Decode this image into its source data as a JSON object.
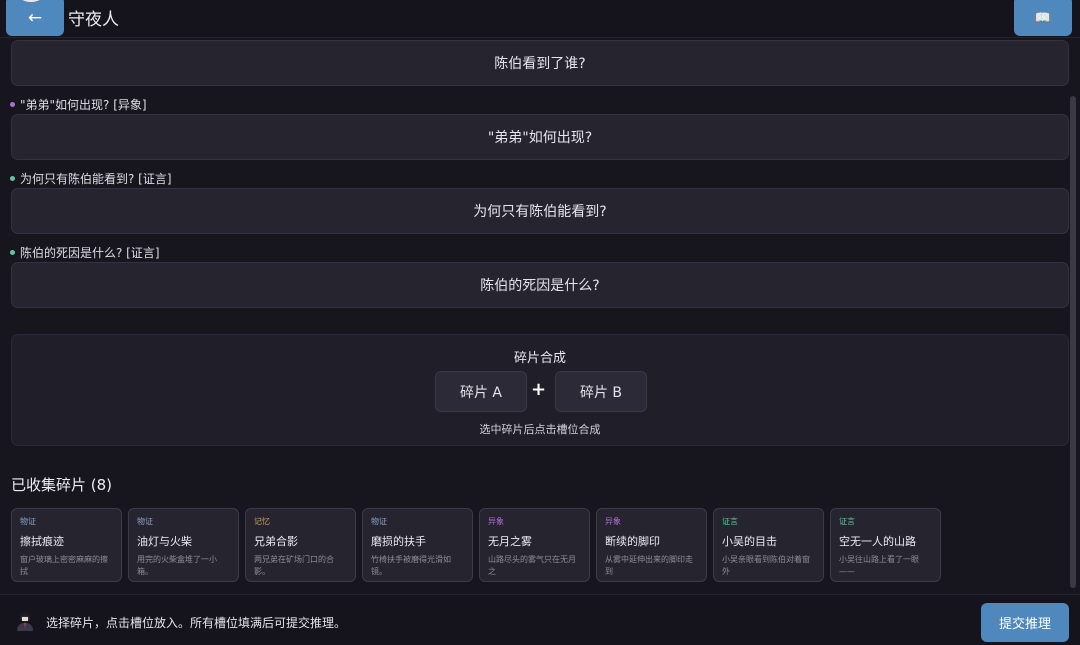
{
  "header": {
    "back_icon": "←",
    "title": "守夜人",
    "book_icon": "📖"
  },
  "questions": [
    {
      "card": "陈伯看到了谁?"
    },
    {
      "label": "\"弟弟\"如何出现? [异象]",
      "dot_color": "#b36bd6",
      "card": "\"弟弟\"如何出现?"
    },
    {
      "label": "为何只有陈伯能看到? [证言]",
      "dot_color": "#5cc8a0",
      "card": "为何只有陈伯能看到?"
    },
    {
      "label": "陈伯的死因是什么? [证言]",
      "dot_color": "#5cc8a0",
      "card": "陈伯的死因是什么?"
    }
  ],
  "synthesis": {
    "title": "碎片合成",
    "slot_a": "碎片 A",
    "plus": "+",
    "slot_b": "碎片 B",
    "hint": "选中碎片后点击槽位合成"
  },
  "collected": {
    "title": "已收集碎片 (8)",
    "fragments": [
      {
        "type": "物证",
        "type_color": "#8aa0c8",
        "name": "擦拭痕迹",
        "desc": "窗户玻璃上密密麻麻的擦拭"
      },
      {
        "type": "物证",
        "type_color": "#8aa0c8",
        "name": "油灯与火柴",
        "desc": "用完的火柴盒堆了一小箱。"
      },
      {
        "type": "记忆",
        "type_color": "#d6a25a",
        "name": "兄弟合影",
        "desc": "两兄弟在矿场门口的合影。"
      },
      {
        "type": "物证",
        "type_color": "#8aa0c8",
        "name": "磨损的扶手",
        "desc": "竹椅扶手被磨得光滑如镜。"
      },
      {
        "type": "异象",
        "type_color": "#b36bd6",
        "name": "无月之雾",
        "desc": "山路尽头的雾气只在无月之"
      },
      {
        "type": "异象",
        "type_color": "#b36bd6",
        "name": "断续的脚印",
        "desc": "从雾中延伸出来的脚印走到"
      },
      {
        "type": "证言",
        "type_color": "#5cc8a0",
        "name": "小吴的目击",
        "desc": "小吴亲眼看到陈伯对着窗外"
      },
      {
        "type": "证言",
        "type_color": "#5cc8a0",
        "name": "空无一人的山路",
        "desc": "小吴往山路上看了一眼——"
      }
    ]
  },
  "footer": {
    "avatar_icon": "detective-avatar-icon",
    "instruction": "选择碎片，点击槽位放入。所有槽位填满后可提交推理。",
    "submit_label": "提交推理"
  },
  "colors": {
    "accent": "#4f88bd",
    "background": "#17161f",
    "card": "#25242f"
  }
}
